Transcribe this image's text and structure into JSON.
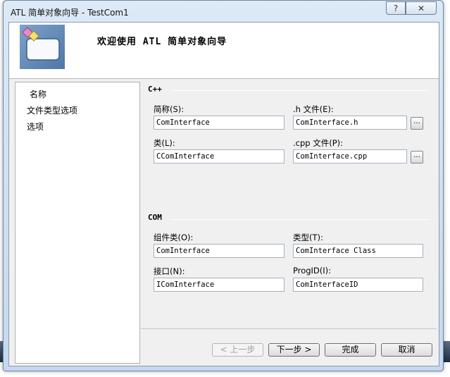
{
  "window": {
    "title": "ATL 简单对象向导 - TestCom1",
    "help_glyph": "?",
    "close_glyph": "✕"
  },
  "header": {
    "title": "欢迎使用 ATL 简单对象向导"
  },
  "nav": {
    "items": [
      {
        "label": "名称",
        "selected": true
      },
      {
        "label": "文件类型选项",
        "selected": false
      },
      {
        "label": "选项",
        "selected": false
      }
    ]
  },
  "cpp_section": {
    "title": "C++",
    "short_name": {
      "label": "简称(S):",
      "value": "ComInterface"
    },
    "h_file": {
      "label": ".h 文件(E):",
      "value": "ComInterface.h"
    },
    "class": {
      "label": "类(L):",
      "value": "CComInterface"
    },
    "cpp_file": {
      "label": ".cpp 文件(P):",
      "value": "ComInterface.cpp"
    },
    "browse_label": "..."
  },
  "com_section": {
    "title": "COM",
    "coclass": {
      "label": "组件类(O):",
      "value": "ComInterface"
    },
    "type": {
      "label": "类型(T):",
      "value": "ComInterface Class"
    },
    "interface": {
      "label": "接口(N):",
      "value": "IComInterface"
    },
    "progid": {
      "label": "ProgID(I):",
      "value": "ComInterfaceID"
    }
  },
  "buttons": {
    "back": "< 上一步",
    "next": "下一步 >",
    "finish": "完成",
    "cancel": "取消"
  },
  "colors": {
    "accent": "#3c7fb1",
    "title_bg": "#dce9f6"
  }
}
